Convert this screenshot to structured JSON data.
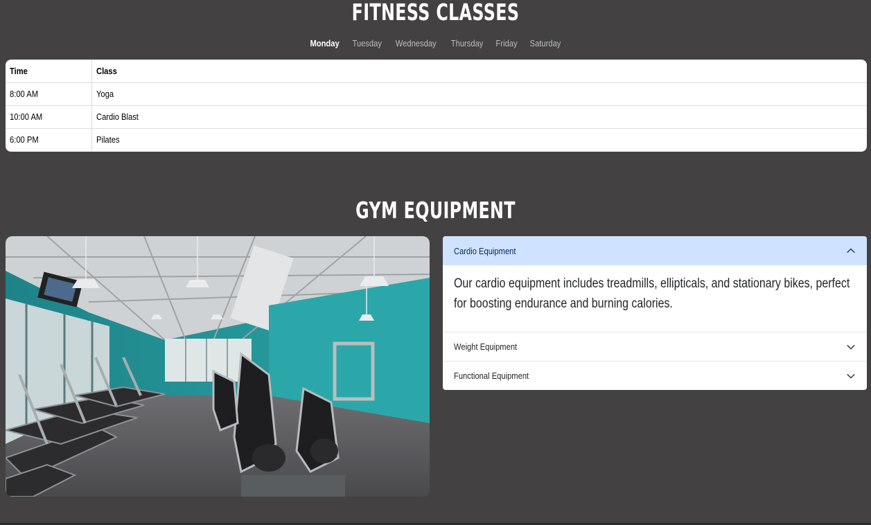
{
  "classes": {
    "title": "FITNESS CLASSES",
    "days": [
      "Monday",
      "Tuesday",
      "Wednesday",
      "Thursday",
      "Friday",
      "Saturday"
    ],
    "active_day": "Monday",
    "table": {
      "headers": [
        "Time",
        "Class"
      ],
      "rows": [
        [
          "8:00 AM",
          "Yoga"
        ],
        [
          "10:00 AM",
          "Cardio Blast"
        ],
        [
          "6:00 PM",
          "Pilates"
        ]
      ]
    }
  },
  "equipment": {
    "title": "GYM EQUIPMENT",
    "accordion": [
      {
        "label": "Cardio Equipment",
        "open": true,
        "body": "Our cardio equipment includes treadmills, ellipticals, and stationary bikes, perfect for boosting endurance and burning calories."
      },
      {
        "label": "Weight Equipment",
        "open": false
      },
      {
        "label": "Functional Equipment",
        "open": false
      }
    ]
  },
  "colors": {
    "background": "#434142",
    "accordion_active": "#cfe2ff",
    "wall_teal": "#2a9a9c"
  }
}
